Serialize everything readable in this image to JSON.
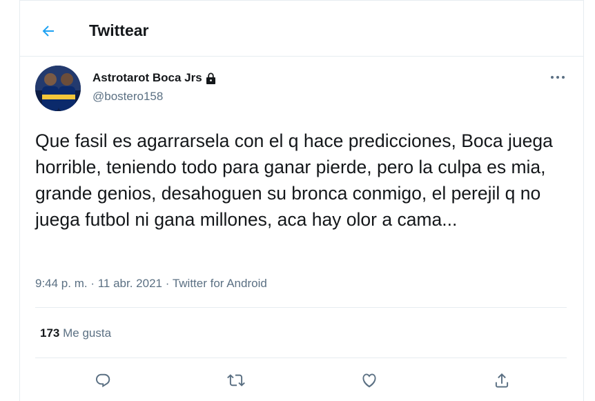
{
  "header": {
    "title": "Twittear"
  },
  "tweet": {
    "author": {
      "display_name": "Astrotarot Boca Jrs",
      "handle": "@bostero158"
    },
    "text": "Que fasil es agarrarsela con el q hace predicciones, Boca juega horrible, teniendo todo para ganar pierde, pero la culpa es mia, grande genios, desahoguen su bronca conmigo, el perejil q no juega futbol ni gana millones, aca hay olor a cama...",
    "time": "9:44 p. m.",
    "sep1": " · ",
    "date": "11 abr. 2021",
    "sep2": " · ",
    "source": "Twitter for Android",
    "likes_count": "173",
    "likes_label": "Me gusta"
  },
  "icons": {
    "back": "arrow-left-icon",
    "lock": "lock-icon",
    "more": "more-horizontal-icon",
    "reply": "reply-icon",
    "retweet": "retweet-icon",
    "like": "heart-icon",
    "share": "share-icon"
  },
  "colors": {
    "accent": "#1da1f2",
    "secondary_text": "#5b7083",
    "border": "#e6ecf0"
  }
}
